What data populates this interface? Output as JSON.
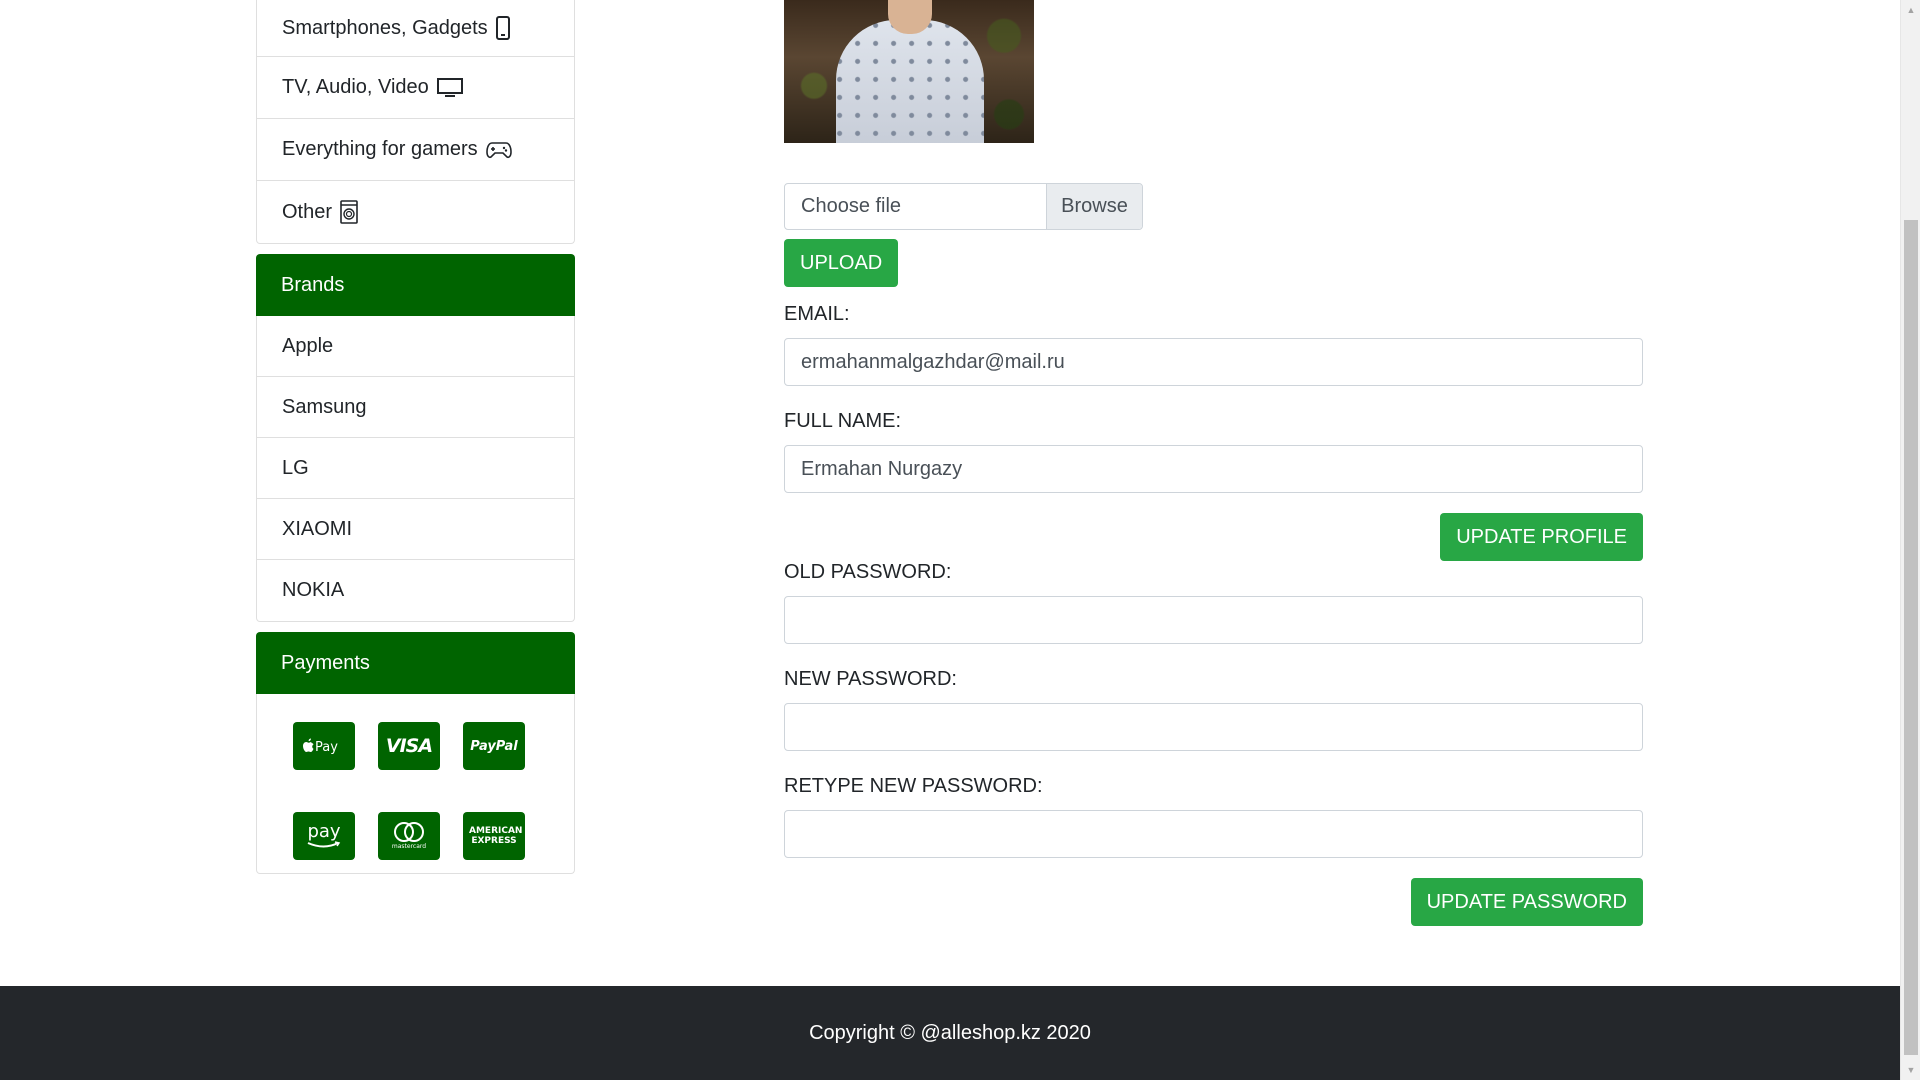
{
  "sidebar": {
    "categories": [
      {
        "label": "Smartphones, Gadgets",
        "icon": "smartphone-icon"
      },
      {
        "label": "TV, Audio, Video",
        "icon": "monitor-icon"
      },
      {
        "label": "Everything for gamers",
        "icon": "gamepad-icon"
      },
      {
        "label": "Other",
        "icon": "washing-machine-icon"
      }
    ],
    "brands_header": "Brands",
    "brands": [
      "Apple",
      "Samsung",
      "LG",
      "XIAOMI",
      "NOKIA"
    ],
    "payments_header": "Payments",
    "payment_methods": [
      {
        "label": "Pay",
        "icon": "apple-pay-icon"
      },
      {
        "label": "VISA",
        "icon": "visa-icon"
      },
      {
        "label": "PayPal",
        "icon": "paypal-icon"
      },
      {
        "label": "pay",
        "icon": "amazon-pay-icon"
      },
      {
        "label": "mastercard",
        "icon": "mastercard-icon"
      },
      {
        "label": "AMERICAN EXPRESS",
        "icon": "amex-icon"
      }
    ]
  },
  "profile": {
    "file_placeholder": "Choose file",
    "browse_label": "Browse",
    "upload_label": "UPLOAD",
    "email_label": "EMAIL:",
    "email_value": "ermahanmalgazhdar@mail.ru",
    "fullname_label": "FULL NAME:",
    "fullname_value": "Ermahan Nurgazy",
    "update_profile_label": "UPDATE PROFILE",
    "old_password_label": "OLD PASSWORD:",
    "new_password_label": "NEW PASSWORD:",
    "retype_password_label": "RETYPE NEW PASSWORD:",
    "update_password_label": "UPDATE PASSWORD"
  },
  "footer": {
    "copyright": "Copyright © @alleshop.kz 2020"
  },
  "colors": {
    "brand_green": "#006400",
    "button_green": "#28a745",
    "footer_bg": "#24272b"
  }
}
